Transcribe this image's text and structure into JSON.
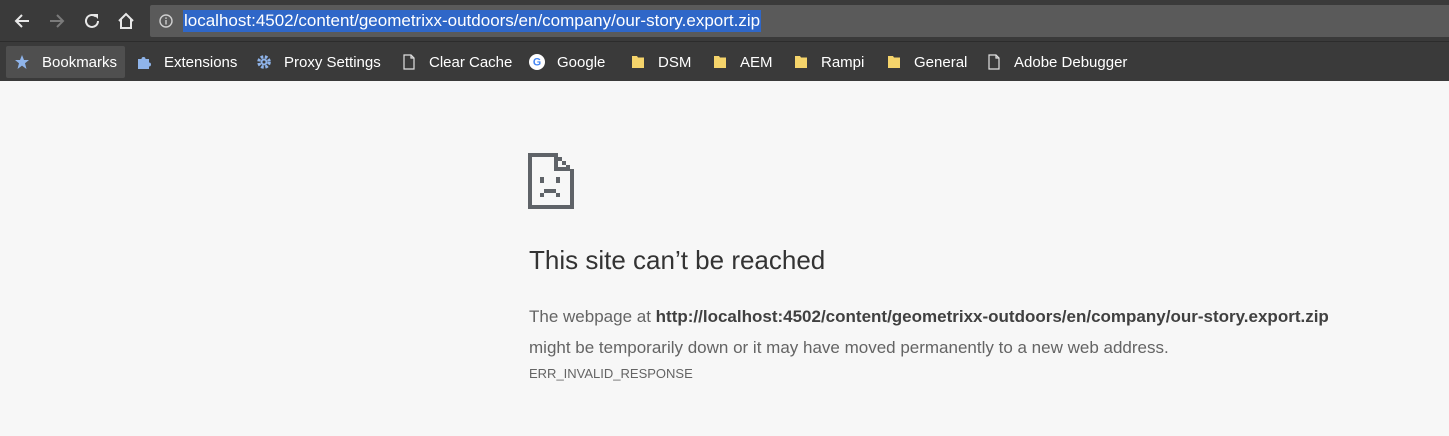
{
  "browser": {
    "url": "localhost:4502/content/geometrixx-outdoors/en/company/our-story.export.zip",
    "nav": {
      "back_icon": "arrow-left-icon",
      "forward_icon": "arrow-right-icon",
      "reload_icon": "reload-icon",
      "home_icon": "home-icon",
      "info_icon": "info-icon"
    }
  },
  "bookmarks": [
    {
      "label": "Bookmarks",
      "icon": "star-icon"
    },
    {
      "label": "Extensions",
      "icon": "puzzle-icon"
    },
    {
      "label": "Proxy Settings",
      "icon": "gear-icon"
    },
    {
      "label": "Clear Cache",
      "icon": "page-icon"
    },
    {
      "label": "Google",
      "icon": "google-icon"
    },
    {
      "label": "DSM",
      "icon": "folder-icon"
    },
    {
      "label": "AEM",
      "icon": "folder-icon"
    },
    {
      "label": "Rampi",
      "icon": "folder-icon"
    },
    {
      "label": "General",
      "icon": "folder-icon"
    },
    {
      "label": "Adobe Debugger",
      "icon": "page-icon"
    }
  ],
  "error": {
    "title": "This site can’t be reached",
    "body_prefix": "The webpage at ",
    "body_url": "http://localhost:4502/content/geometrixx-outdoors/en/company/our-story.export.zip",
    "body_suffix": " might be temporarily down or it may have moved permanently to a new web address.",
    "code": "ERR_INVALID_RESPONSE"
  },
  "colors": {
    "toolbar": "#3a3a3a",
    "omnibox": "#5a5a5a",
    "selection": "#2f67c8",
    "page_bg": "#f7f7f7",
    "folder": "#f5d46b"
  }
}
